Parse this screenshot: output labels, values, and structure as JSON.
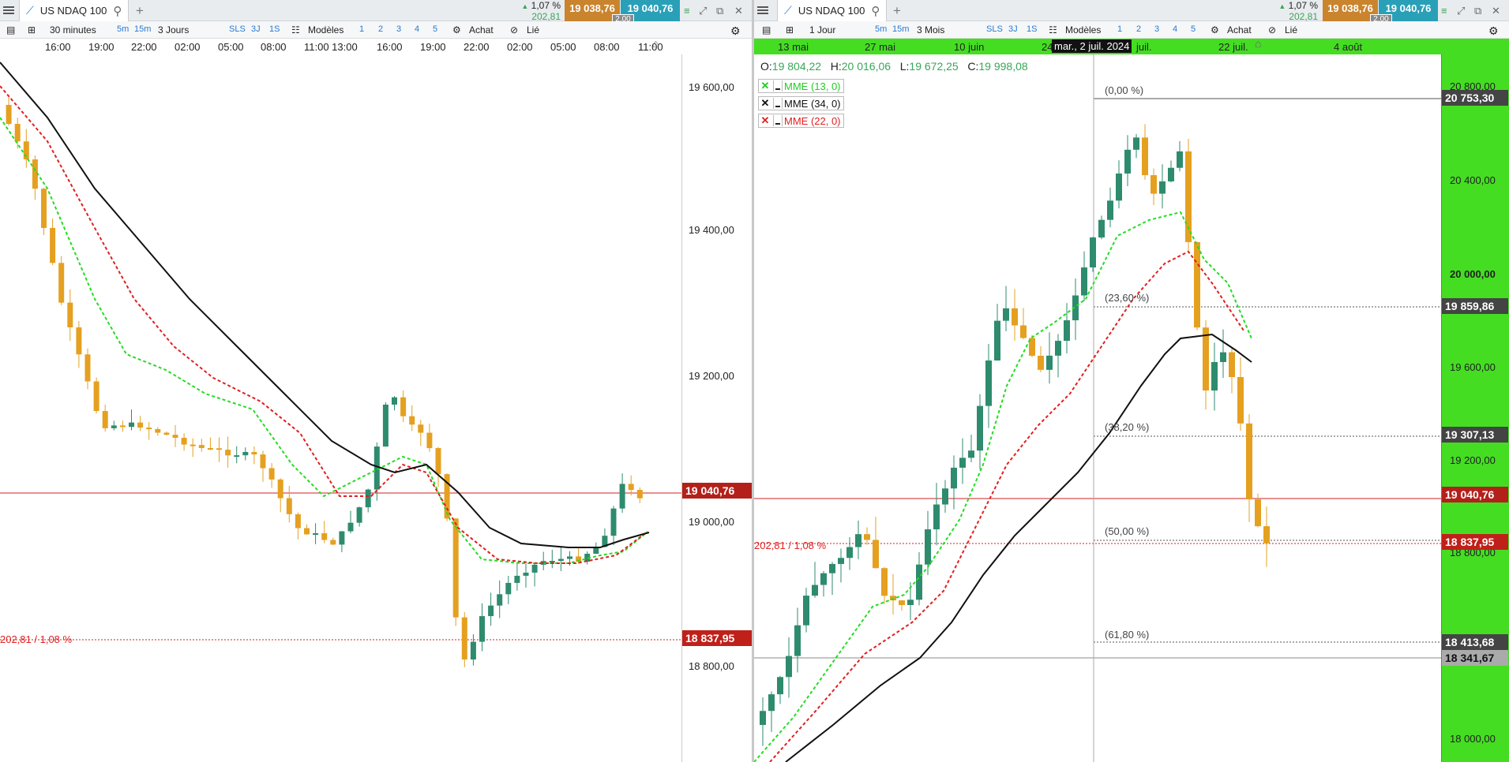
{
  "left_window": {
    "tab_title": "US NDAQ 100",
    "change_pct": "1,07 %",
    "change_abs": "202,81",
    "bid": "19 038,76",
    "ask": "19 040,76",
    "spread": "2,00",
    "toolbar": {
      "timeframe": "30 minutes",
      "tf_5m": "5m",
      "tf_15m": "15m",
      "range": "3 Jours",
      "sls": "SLS",
      "r3j": "3J",
      "r1s": "1S",
      "models": "Modèles",
      "n1": "1",
      "n2": "2",
      "n3": "3",
      "n4": "4",
      "n5": "5",
      "buy": "Achat",
      "linked": "Lié"
    },
    "time_labels": [
      "16:00",
      "19:00",
      "22:00",
      "02:00",
      "05:00",
      "08:00",
      "11:00 13:00",
      "16:00",
      "19:00",
      "22:00",
      "02:00",
      "05:00",
      "08:00",
      "11:00"
    ],
    "y_labels": [
      "19 600,00",
      "19 400,00",
      "19 200,00",
      "19 000,00",
      "18 800,00"
    ],
    "current_price": "19 040,76",
    "ref_price": "18 837,95",
    "ref_label": "202,81 / 1,08 %"
  },
  "right_window": {
    "tab_title": "US NDAQ 100",
    "change_pct": "1,07 %",
    "change_abs": "202,81",
    "bid": "19 038,76",
    "ask": "19 040,76",
    "spread": "2,00",
    "toolbar": {
      "timeframe": "1 Jour",
      "tf_5m": "5m",
      "tf_15m": "15m",
      "range": "3 Mois",
      "sls": "SLS",
      "r3j": "3J",
      "r1s": "1S",
      "models": "Modèles",
      "n1": "1",
      "n2": "2",
      "n3": "3",
      "n4": "4",
      "n5": "5",
      "buy": "Achat",
      "linked": "Lié"
    },
    "time_labels": [
      "13 mai",
      "27 mai",
      "10 juin",
      "24",
      "juil.",
      "22 juil.",
      "4 août"
    ],
    "crosshair_date": "mar., 2 juil. 2024",
    "ohlc": {
      "o_label": "O:",
      "o": "19 804,22",
      "h_label": "H:",
      "h": "20 016,06",
      "l_label": "L:",
      "l": "19 672,25",
      "c_label": "C:",
      "c": "19 998,08"
    },
    "legend": [
      {
        "label": "MME (13, 0)",
        "color": "#22cc22"
      },
      {
        "label": "MME (34, 0)",
        "color": "#111111"
      },
      {
        "label": "MME (22, 0)",
        "color": "#e02020"
      }
    ],
    "fib_levels": [
      "(0,00 %)",
      "(23,60 %)",
      "(38,20 %)",
      "(50,00 %)",
      "(61,80 %)"
    ],
    "y_labels": [
      "20 800,00",
      "20 400,00",
      "20 000,00",
      "19 600,00",
      "19 200,00",
      "18 800,00",
      "18 000,00"
    ],
    "fib_prices": [
      "20 753,30",
      "19 859,86",
      "19 307,13",
      "18 413,68"
    ],
    "current_price": "19 040,76",
    "ref_price": "18 837,95",
    "crosshair_price": "18 341,67",
    "ref_label": "202,81 / 1,08 %"
  },
  "colors": {
    "bull": "#2e8b6e",
    "bear": "#e5a020",
    "ema_fast": "#22dd22",
    "ema_mid": "#e02020",
    "ema_slow": "#111111",
    "price_red": "#c0201a",
    "accent_green": "#44dd22"
  }
}
